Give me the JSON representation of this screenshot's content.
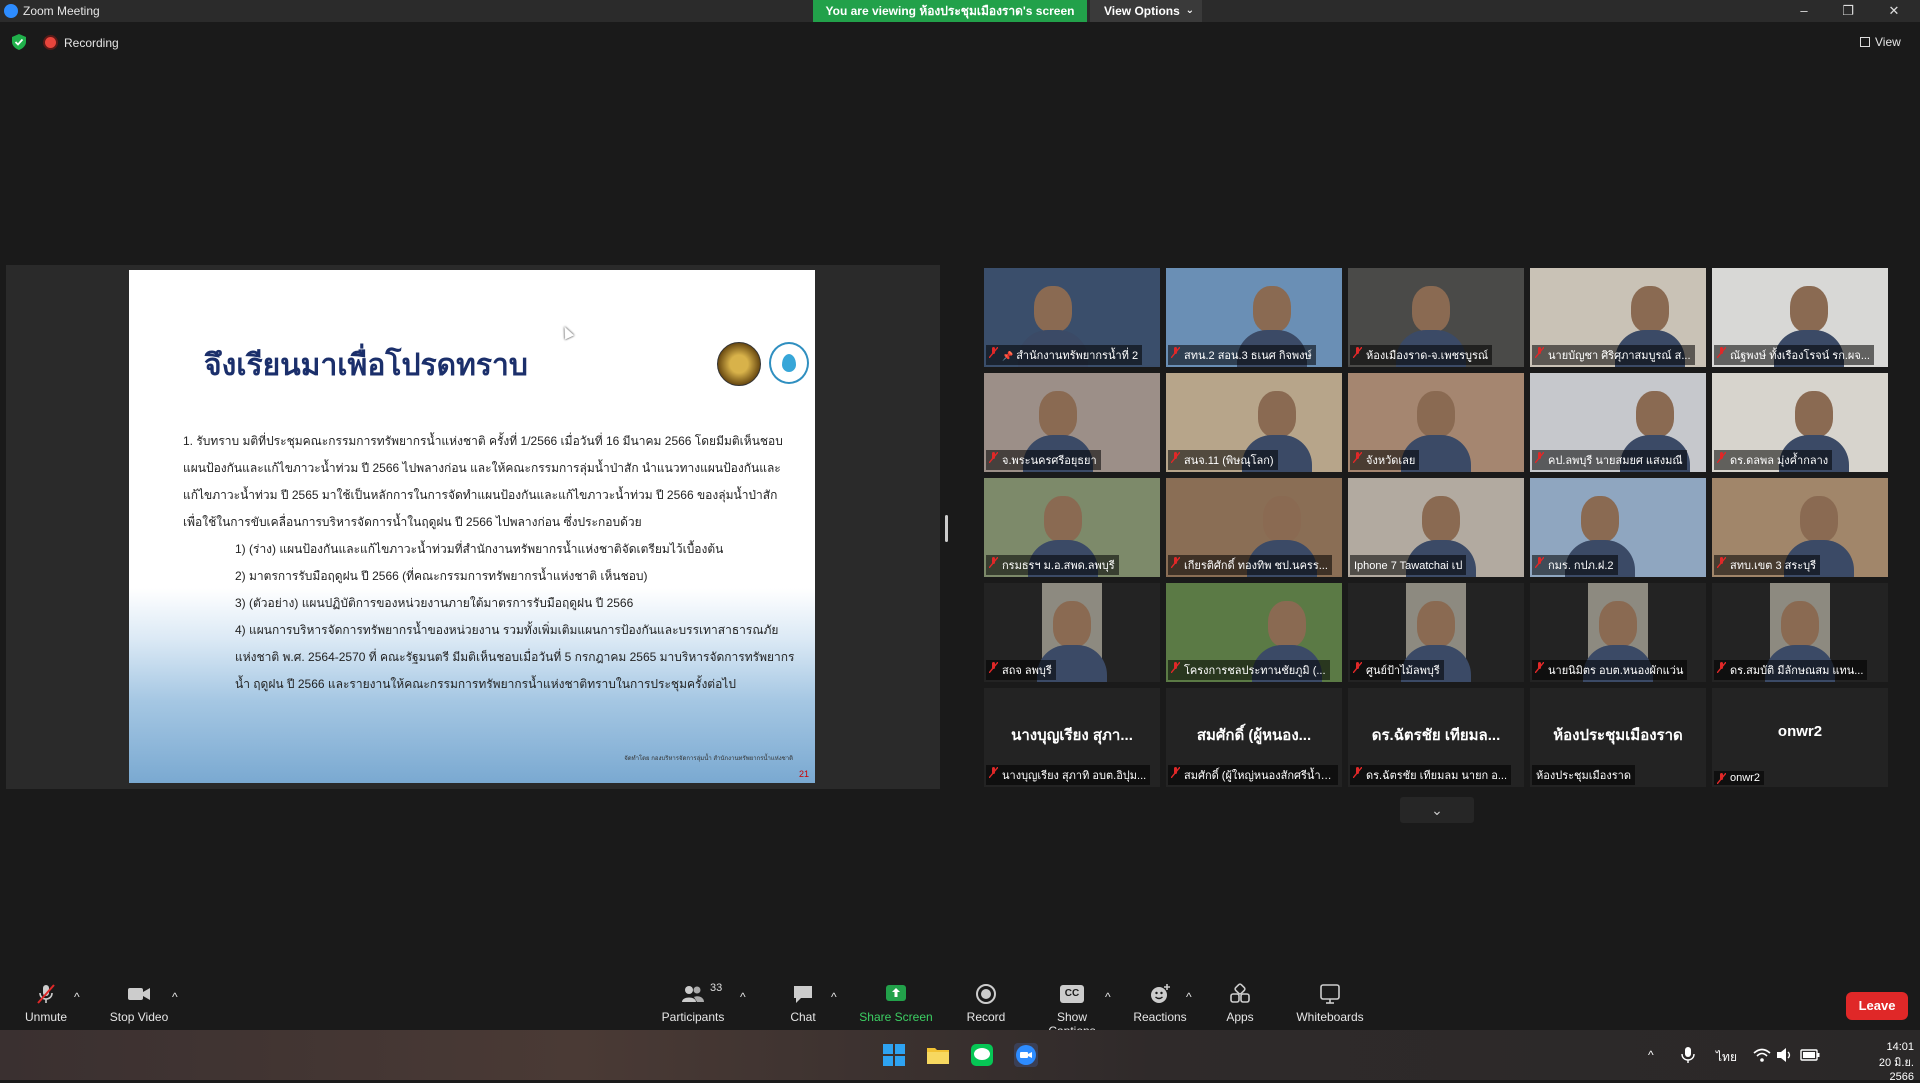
{
  "window": {
    "title": "Zoom Meeting",
    "banner": "You are viewing ห้องประชุมเมืองราด's screen",
    "view_options": "View Options",
    "minimize": "–",
    "maximize": "❐",
    "close": "✕"
  },
  "meeting": {
    "recording": "Recording",
    "view": "View"
  },
  "slide": {
    "title": "จึงเรียนมาเพื่อโปรดทราบ",
    "para1": "1. รับทราบ มติที่ประชุมคณะกรรมการทรัพยากรน้ำแห่งชาติ ครั้งที่ 1/2566 เมื่อวันที่ 16 มีนาคม 2566 โดยมีมติเห็นชอบ แผนป้องกันและแก้ไขภาวะน้ำท่วม ปี 2566 ไปพลางก่อน และให้คณะกรรมการลุ่มน้ำป่าสัก นำแนวทางแผนป้องกันและแก้ไขภาวะน้ำท่วม ปี 2565 มาใช้เป็นหลักการในการจัดทำแผนป้องกันและแก้ไขภาวะน้ำท่วม ปี 2566 ของลุ่มน้ำป่าสัก เพื่อใช้ในการขับเคลื่อนการบริหารจัดการน้ำในฤดูฝน ปี 2566 ไปพลางก่อน ซึ่งประกอบด้วย",
    "item1": "1) (ร่าง) แผนป้องกันและแก้ไขภาวะน้ำท่วมที่สำนักงานทรัพยากรน้ำแห่งชาติจัดเตรียมไว้เบื้องต้น",
    "item2": "2) มาตรการรับมือฤดูฝน ปี 2566 (ที่คณะกรรมการทรัพยากรน้ำแห่งชาติ เห็นชอบ)",
    "item3": "3) (ตัวอย่าง) แผนปฏิบัติการของหน่วยงานภายใต้มาตรการรับมือฤดูฝน ปี 2566",
    "item4": "4) แผนการบริหารจัดการทรัพยากรน้ำของหน่วยงาน รวมทั้งเพิ่มเติมแผนการป้องกันและบรรเทาสาธารณภัยแห่งชาติ พ.ศ. 2564-2570 ที่ คณะรัฐมนตรี มีมติเห็นชอบเมื่อวันที่ 5 กรกฎาคม 2565 มาบริหารจัดการทรัพยากรน้ำ ฤดูฝน ปี 2566 และรายงานให้คณะกรรมการทรัพยากรน้ำแห่งชาติทราบในการประชุมครั้งต่อไป",
    "footer": "จัดทำโดย กองบริหารจัดการลุ่มน้ำ สำนักงานทรัพยากรน้ำแห่งชาติ",
    "page": "21"
  },
  "gallery": [
    {
      "name": "สำนักงานทรัพยากรน้ำที่ 2",
      "bg": "#3a4e6b",
      "pin": true
    },
    {
      "name": "สทน.2 สอน.3 ธเนศ กิจพงษ์",
      "bg": "#6a8fb5"
    },
    {
      "name": "ห้องเมืองราด-จ.เพชรบูรณ์",
      "bg": "#4a4a48",
      "active": true
    },
    {
      "name": "นายบัญชา ศิริศุภาสมบูรณ์ ส...",
      "bg": "#c9c2b6"
    },
    {
      "name": "ณัฐพงษ์ ทั้งเรืองโรจน์ รก.ผจ...",
      "bg": "#d8d8d6"
    },
    {
      "name": "จ.พระนครศรีอยุธยา",
      "bg": "#9c8f88"
    },
    {
      "name": "สนจ.11 (พิษณุโลก)",
      "bg": "#b7a58a"
    },
    {
      "name": "จังหวัดเลย",
      "bg": "#a58670"
    },
    {
      "name": "คป.ลพบุรี นายสมยศ แสงมณี",
      "bg": "#c6c8cc"
    },
    {
      "name": "ดร.ดลพล มุ่งค้ำกลาง",
      "bg": "#d7d4cd"
    },
    {
      "name": "กรมธรฯ ม.อ.สพด.ลพบุรี",
      "bg": "#7d8a6a"
    },
    {
      "name": "เกียรติศักดิ์ ทองทิพ ชป.นครร...",
      "bg": "#8a6e55"
    },
    {
      "name": "Iphone 7 Tawatchai เป",
      "bg": "#b2aaa0",
      "nomic": true
    },
    {
      "name": "กมร. กปภ.ฝ.2",
      "bg": "#8fa6c0"
    },
    {
      "name": "สทบ.เขต 3 สระบุรี",
      "bg": "#a1866a"
    },
    {
      "name": "สถจ ลพบุรี",
      "bg": "#111111"
    },
    {
      "name": "โครงการชลประทานชัยภูมิ (...",
      "bg": "#5b7a45"
    },
    {
      "name": "ศูนย์ป้าไม้ลพบุรี",
      "bg": "#111111"
    },
    {
      "name": "นายนิมิตร อบต.หนองผักแว่น",
      "bg": "#1a1a1a"
    },
    {
      "name": "ดร.สมบัติ มีลักษณสม แทน...",
      "bg": "#1c1c1c"
    },
    {
      "name": "นางบุญเรียง สุภาทิ อบต.อิปุม...",
      "display": "นางบุญเรียง สุภา..."
    },
    {
      "name": "สมศักดิ์ (ผู้ใหญ่หนองสักศรีน้ำก...",
      "display": "สมศักดิ์ (ผู้หนอง..."
    },
    {
      "name": "ดร.ฉัตรชัย เทียมลม นายก อ...",
      "display": "ดร.ฉัตรชัย เทียมล..."
    },
    {
      "name": "ห้องประชุมเมืองราด",
      "display": "ห้องประชุมเมืองราด",
      "nomic": true
    },
    {
      "name": "onwr2",
      "display": "onwr2"
    }
  ],
  "toolbar": {
    "unmute": "Unmute",
    "stop_video": "Stop Video",
    "participants": "Participants",
    "participants_count": "33",
    "chat": "Chat",
    "share_screen": "Share Screen",
    "record": "Record",
    "captions": "Show Captions",
    "captions_icon": "CC",
    "reactions": "Reactions",
    "apps": "Apps",
    "whiteboards": "Whiteboards",
    "leave": "Leave"
  },
  "taskbar": {
    "lang": "ไทย",
    "time": "14:01",
    "date": "20 มิ.ย. 2566"
  },
  "colors": {
    "accent": "#2d8cff",
    "share_green": "#22a14a",
    "leave_red": "#e02828",
    "active_speaker": "#d9e34a"
  }
}
